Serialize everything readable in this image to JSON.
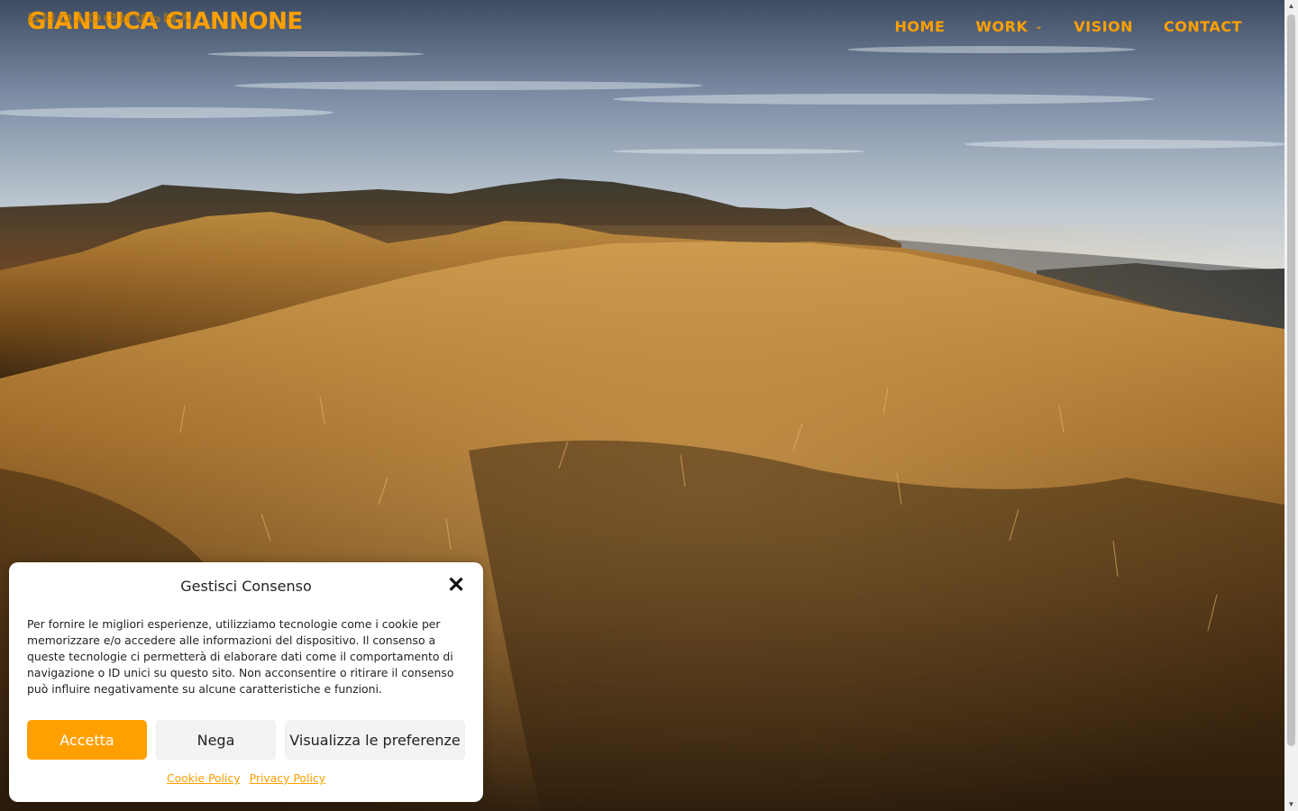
{
  "brand": {
    "name": "GIANLUCA GIANNONE",
    "subtitle": "PHOTOGRAPHY",
    "accent_color": "#ffa000"
  },
  "nav": {
    "items": [
      {
        "label": "HOME"
      },
      {
        "label": "WORK",
        "icon": "chevron-down-icon"
      },
      {
        "label": "VISION"
      },
      {
        "label": "CONTACT"
      }
    ]
  },
  "consent": {
    "title": "Gestisci Consenso",
    "close_icon": "close-icon",
    "text": "Per fornire le migliori esperienze, utilizziamo tecnologie come i cookie per memorizzare e/o accedere alle informazioni del dispositivo. Il consenso a queste tecnologie ci permetterà di elaborare dati come il comportamento di navigazione o ID unici su questo sito. Non acconsentire o ritirare il consenso può influire negativamente su alcune caratteristiche e funzioni.",
    "accept_label": "Accetta",
    "deny_label": "Nega",
    "preferences_label": "Visualizza le preferenze",
    "cookie_policy_label": "Cookie Policy",
    "privacy_policy_label": "Privacy Policy"
  }
}
